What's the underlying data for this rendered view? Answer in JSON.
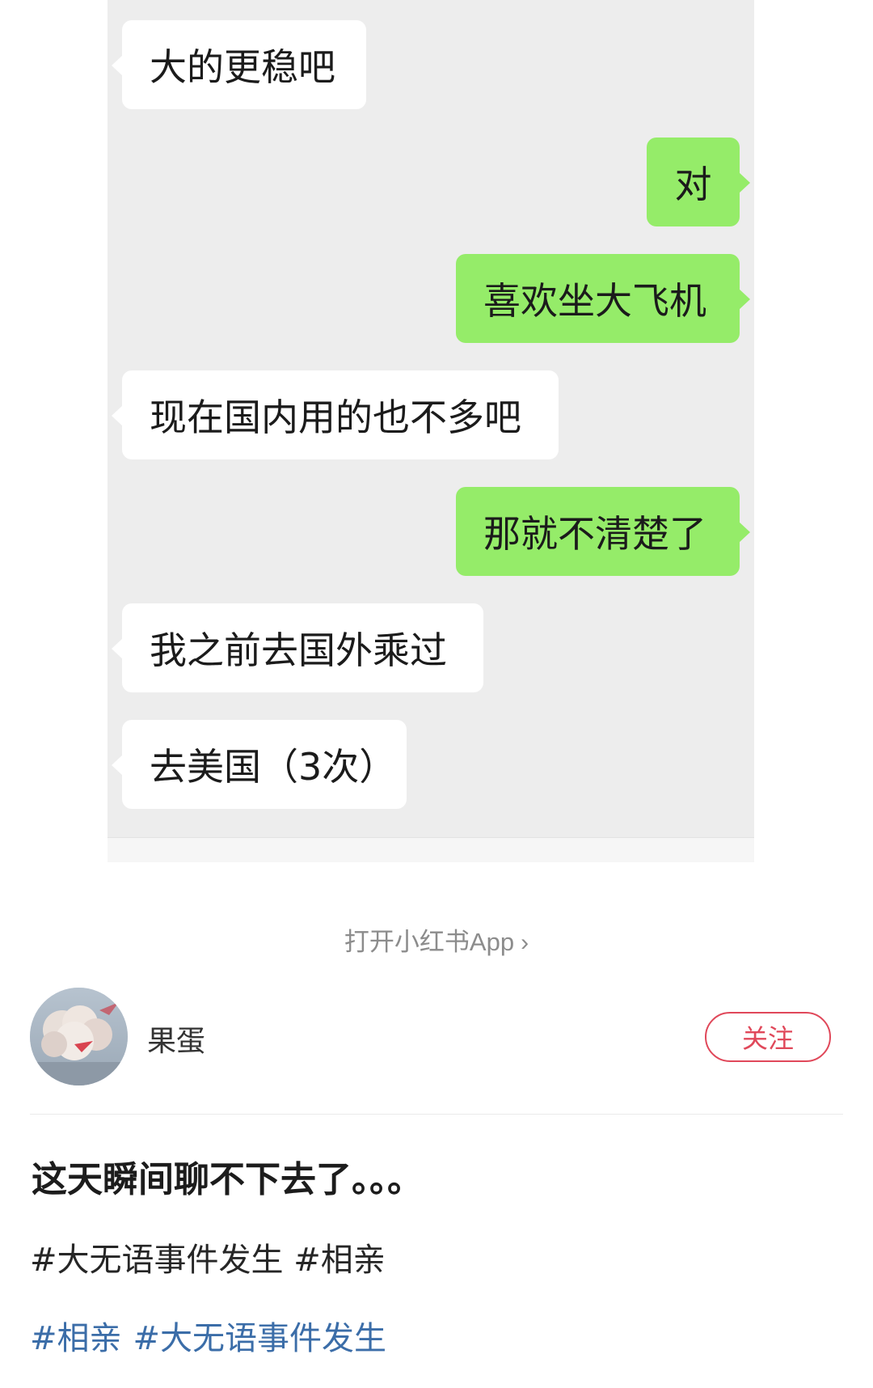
{
  "chat": {
    "messages": [
      {
        "side": "left",
        "text": "大的更稳吧"
      },
      {
        "side": "right",
        "text": "对"
      },
      {
        "side": "right",
        "text": "喜欢坐大飞机"
      },
      {
        "side": "left",
        "text": "现在国内用的也不多吧"
      },
      {
        "side": "right",
        "text": "那就不清楚了"
      },
      {
        "side": "left",
        "text": "我之前去国外乘过"
      },
      {
        "side": "left",
        "text": "去美国（3次）"
      }
    ]
  },
  "open_app": {
    "label": "打开小红书App",
    "icon": "chevron-right-icon"
  },
  "author": {
    "name": "果蛋",
    "follow_label": "关注",
    "avatar_icon": "cloud-avatar"
  },
  "post": {
    "title": "这天瞬间聊不下去了。。。",
    "tags_text": "#大无语事件发生 #相亲",
    "tag_links": [
      "#相亲",
      "#大无语事件发生"
    ]
  },
  "colors": {
    "chat_background": "#ededed",
    "sent_bubble": "#95ec69",
    "received_bubble": "#ffffff",
    "follow_accent": "#e0485a",
    "tag_link": "#3b6da8"
  }
}
